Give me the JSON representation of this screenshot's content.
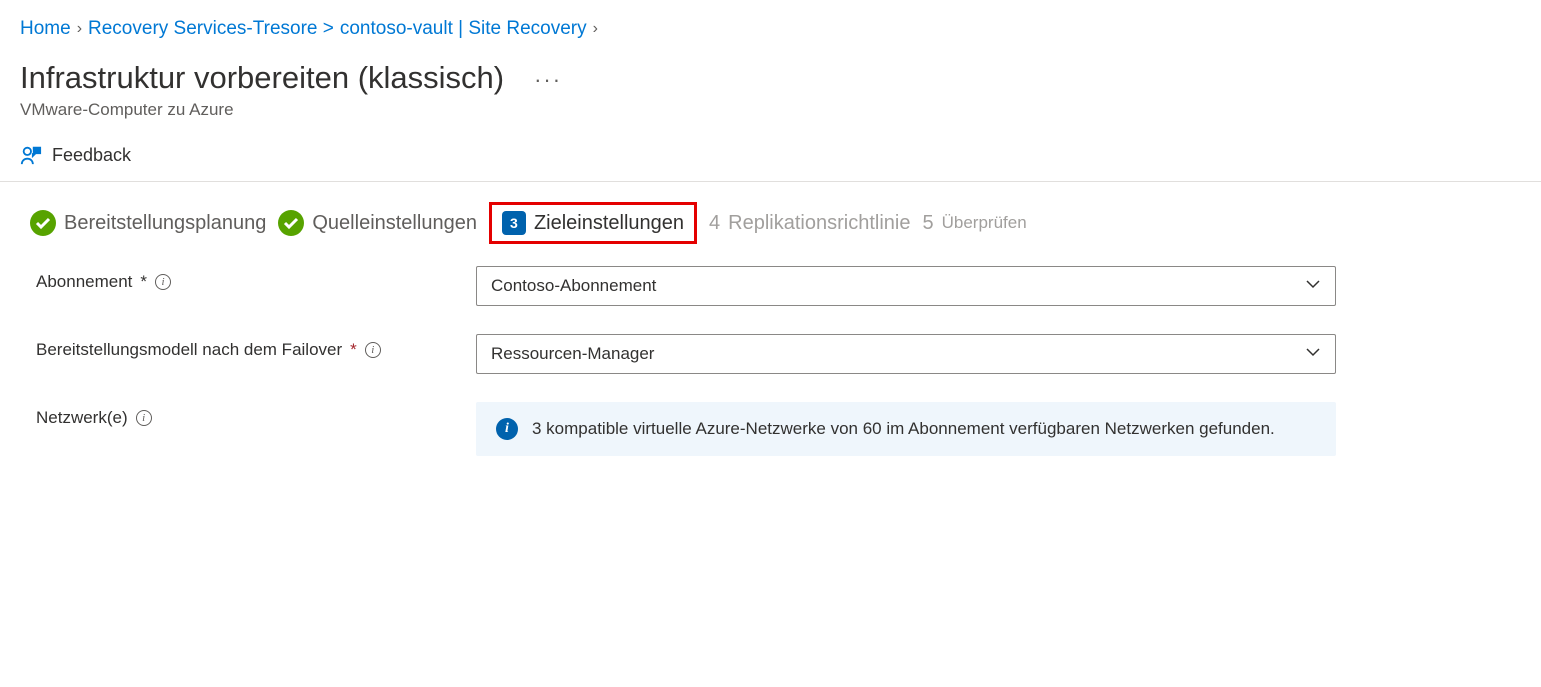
{
  "breadcrumb": {
    "home": "Home",
    "recovery": "Recovery Services-Tresore >",
    "vault": "contoso-vault | Site Recovery"
  },
  "header": {
    "title": "Infrastruktur vorbereiten (klassisch)",
    "subtitle": "VMware-Computer zu Azure"
  },
  "toolbar": {
    "feedback": "Feedback"
  },
  "steps": {
    "s1": "Bereitstellungsplanung",
    "s2": "Quelleinstellungen",
    "s3_num": "3",
    "s3": "Zieleinstellungen",
    "s4_num": "4",
    "s4": "Replikationsrichtlinie",
    "s5_num": "5",
    "s5": "Überprüfen"
  },
  "form": {
    "subscription_label": "Abonnement",
    "subscription_value": "Contoso-Abonnement",
    "deployment_label": "Bereitstellungsmodell nach dem Failover",
    "deployment_value": "Ressourcen-Manager",
    "network_label": "Netzwerk(e)",
    "network_info": "3 kompatible virtuelle Azure-Netzwerke von 60 im Abonnement verfügbaren Netzwerken gefunden."
  }
}
